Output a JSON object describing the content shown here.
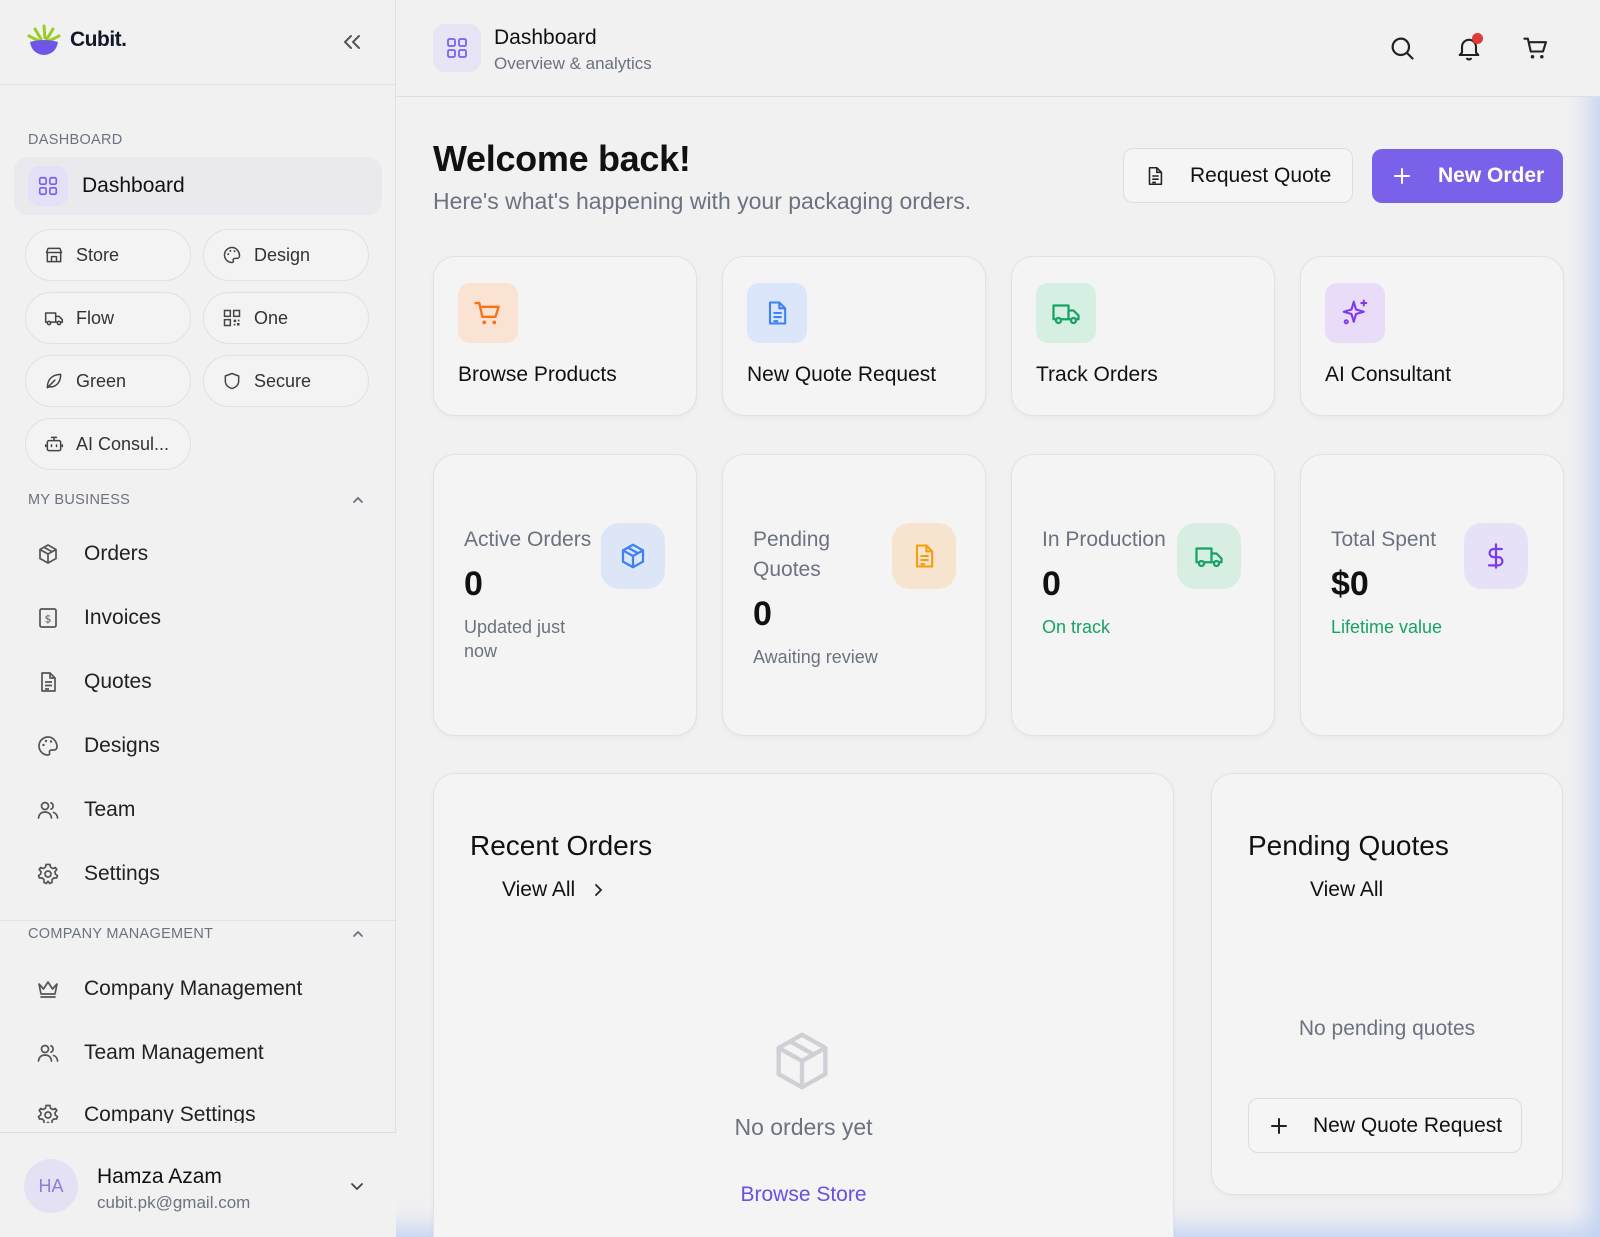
{
  "brand": {
    "name": "Cubit."
  },
  "sidebar": {
    "section_dashboard": "DASHBOARD",
    "dashboard_item": "Dashboard",
    "pills": [
      "Store",
      "Design",
      "Flow",
      "One",
      "Green",
      "Secure",
      "AI Consul..."
    ],
    "section_business": "MY BUSINESS",
    "business_items": [
      "Orders",
      "Invoices",
      "Quotes",
      "Designs",
      "Team",
      "Settings"
    ],
    "section_company": "COMPANY MANAGEMENT",
    "company_items": [
      "Company Management",
      "Team Management",
      "Company Settings"
    ]
  },
  "user": {
    "initials": "HA",
    "name": "Hamza Azam",
    "email": "cubit.pk@gmail.com"
  },
  "topbar": {
    "title": "Dashboard",
    "subtitle": "Overview & analytics"
  },
  "main": {
    "welcome": "Welcome back!",
    "welcome_sub": "Here's what's happening with your packaging orders.",
    "request_quote": "Request Quote",
    "new_order": "New Order"
  },
  "quick_actions": [
    "Browse Products",
    "New Quote Request",
    "Track Orders",
    "AI Consultant"
  ],
  "stats": [
    {
      "label": "Active Orders",
      "value": "0",
      "note": "Updated just now"
    },
    {
      "label": "Pending Quotes",
      "value": "0",
      "note": "Awaiting review"
    },
    {
      "label": "In Production",
      "value": "0",
      "note": "On track"
    },
    {
      "label": "Total Spent",
      "value": "$0",
      "note": "Lifetime value"
    }
  ],
  "recent_orders": {
    "title": "Recent Orders",
    "view_all": "View All",
    "empty": "No orders yet",
    "link": "Browse Store"
  },
  "pending_quotes": {
    "title": "Pending Quotes",
    "view_all": "View All",
    "empty": "No pending quotes",
    "button": "New Quote Request"
  },
  "colors": {
    "accent": "#7b61ea",
    "orange": "#f97316",
    "blue": "#3b82f6",
    "green": "#16a364",
    "purple": "#7c3aed",
    "notification": "#e03b3b"
  }
}
